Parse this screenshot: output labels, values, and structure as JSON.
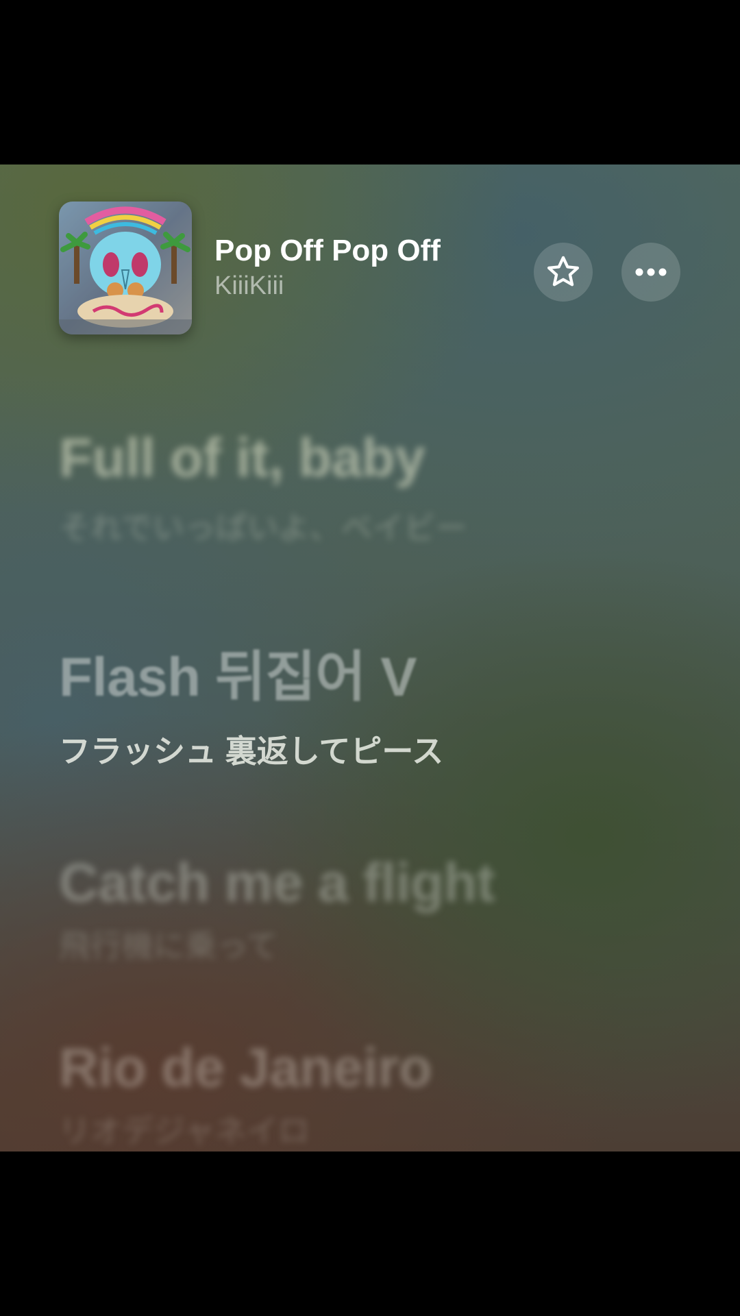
{
  "now_playing": {
    "title": "Pop Off Pop Off",
    "artist": "KiiiKiii",
    "artwork_icon": "album-artwork",
    "favorite_icon": "star-icon",
    "more_icon": "ellipsis-icon"
  },
  "lyrics": [
    {
      "line": "Full of it, baby",
      "translation": "それでいっぱいよ、ベイビー"
    },
    {
      "line": "Flash 뒤집어 V",
      "translation": "フラッシュ 裏返してピース"
    },
    {
      "line": "Catch me a flight",
      "translation": "飛行機に乗って"
    },
    {
      "line": "Rio de Janeiro",
      "translation": "リオデジャネイロ"
    }
  ],
  "colors": {
    "letterbox": "#000000",
    "text_primary": "#ffffff",
    "button_bg": "rgba(255,255,255,0.16)"
  }
}
